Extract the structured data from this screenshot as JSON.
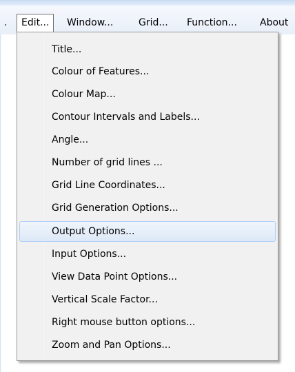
{
  "menubar": {
    "items": [
      {
        "label": "."
      },
      {
        "label": "Edit..."
      },
      {
        "label": "Window..."
      },
      {
        "label": "Grid..."
      },
      {
        "label": "Function..."
      },
      {
        "label": "About"
      }
    ],
    "open_menu": "Edit..."
  },
  "edit_menu": {
    "items": [
      {
        "label": "Title..."
      },
      {
        "label": "Colour of Features..."
      },
      {
        "label": "Colour Map..."
      },
      {
        "label": "Contour Intervals and Labels..."
      },
      {
        "label": "Angle..."
      },
      {
        "label": "Number of grid lines ..."
      },
      {
        "label": "Grid Line Coordinates..."
      },
      {
        "label": "Grid Generation Options..."
      },
      {
        "label": "Output Options..."
      },
      {
        "label": "Input Options..."
      },
      {
        "label": "View Data Point Options..."
      },
      {
        "label": "Vertical Scale Factor..."
      },
      {
        "label": "Right mouse button options..."
      },
      {
        "label": "Zoom and Pan Options..."
      }
    ],
    "highlighted_item": "Output Options..."
  },
  "colors": {
    "menubar_bg": "#e9eff8",
    "menu_bg": "#f1f1f1",
    "highlight_border": "#aecff7",
    "highlight_bg": "#dde9f7"
  }
}
